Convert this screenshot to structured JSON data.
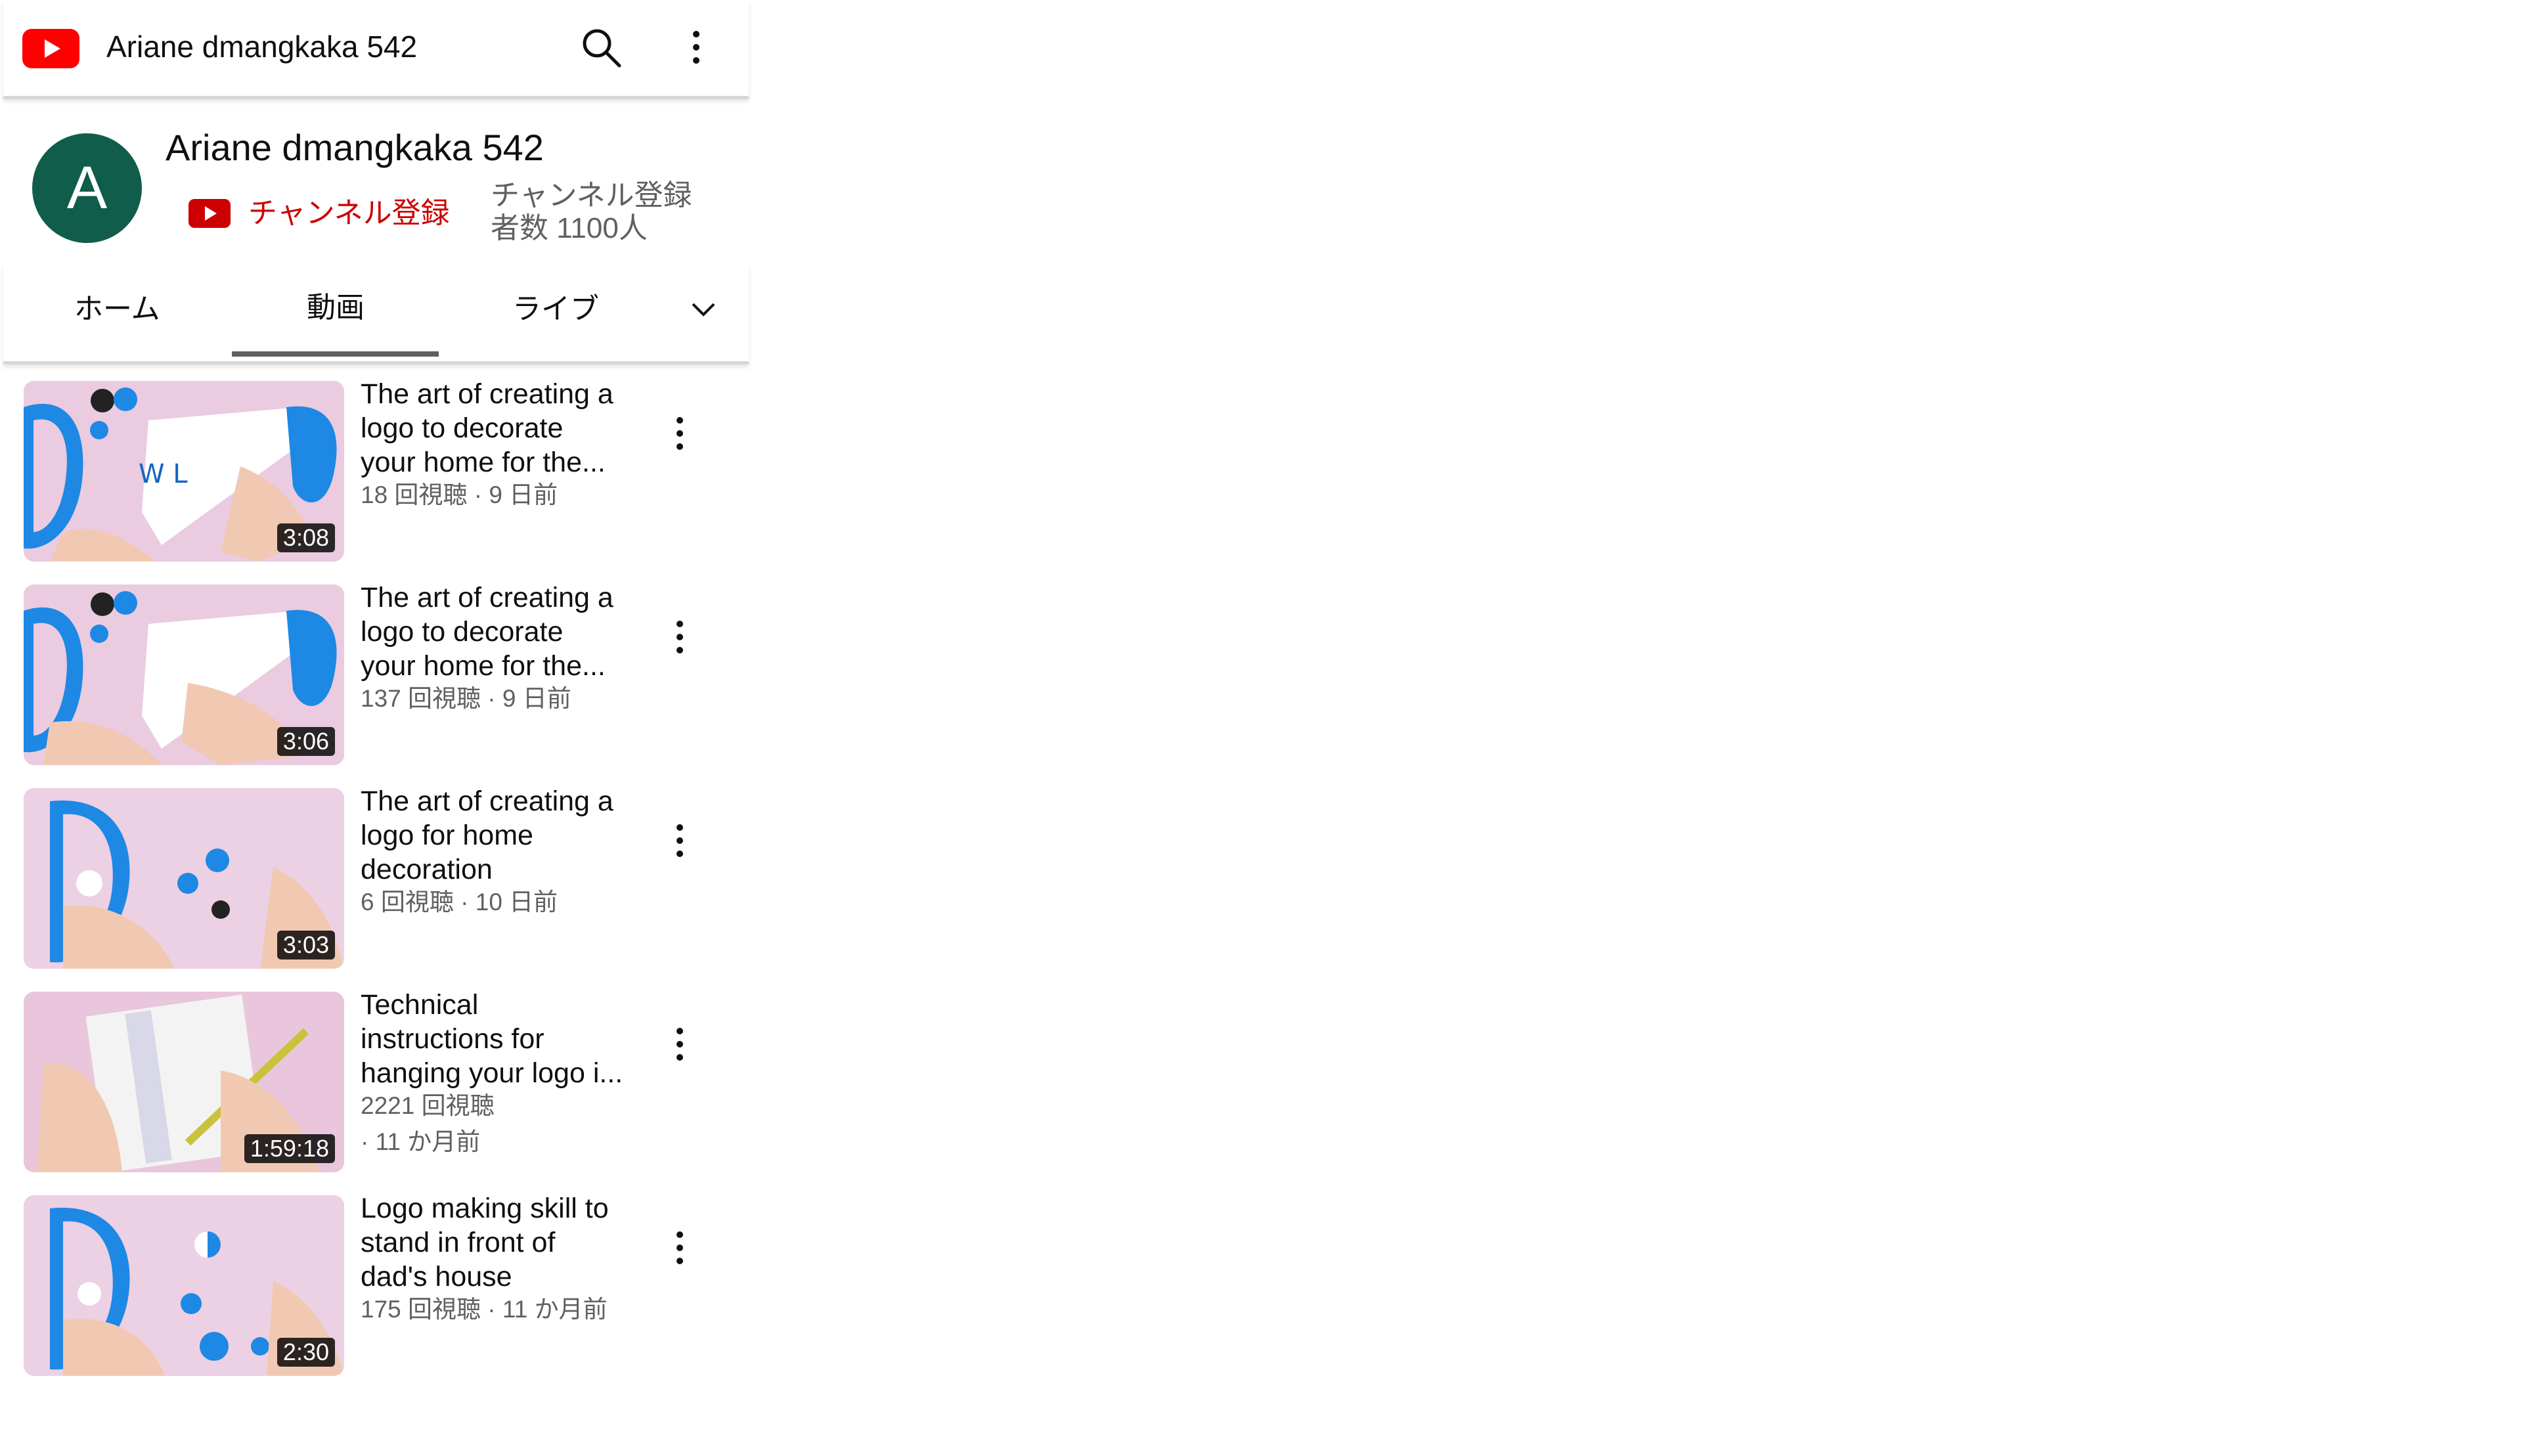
{
  "header": {
    "logo_icon": "youtube-logo-icon",
    "title": "Ariane dmangkaka 542",
    "search_icon": "search-icon",
    "more_icon": "more-vert-icon"
  },
  "channel": {
    "avatar_letter": "A",
    "avatar_color": "#0f5d4a",
    "name": "Ariane dmangkaka 542",
    "subscribe_label": "チャンネル登録",
    "subscriber_line1": "チャンネル登録",
    "subscriber_line2": "者数 1100人"
  },
  "tabs": [
    {
      "label": "ホーム"
    },
    {
      "label": "動画",
      "selected": true
    },
    {
      "label": "ライブ"
    }
  ],
  "tabs_more_icon": "chevron-down-icon",
  "videos": [
    {
      "title_lines": [
        "The art of creating a",
        "logo to decorate",
        "your home for the..."
      ],
      "meta_lines": [
        "18 回視聴 · 9 日前"
      ],
      "duration": "3:08"
    },
    {
      "title_lines": [
        "The art of creating a",
        "logo to decorate",
        "your home for the..."
      ],
      "meta_lines": [
        "137 回視聴 · 9 日前"
      ],
      "duration": "3:06"
    },
    {
      "title_lines": [
        "The art of creating a",
        "logo for home",
        "decoration"
      ],
      "meta_lines": [
        "6 回視聴 · 10 日前"
      ],
      "duration": "3:03"
    },
    {
      "title_lines": [
        "Technical",
        "instructions for",
        "hanging your logo i..."
      ],
      "meta_lines": [
        "2221 回視聴",
        " · 11 か月前"
      ],
      "duration": "1:59:18"
    },
    {
      "title_lines": [
        "Logo making skill to",
        "stand in front of",
        "dad's house"
      ],
      "meta_lines": [
        "175 回視聴 · 11 か月前"
      ],
      "duration": "2:30"
    }
  ],
  "colors": {
    "brand_red": "#ff0000",
    "subscribe_red": "#cc0000",
    "secondary_text": "#606060"
  }
}
